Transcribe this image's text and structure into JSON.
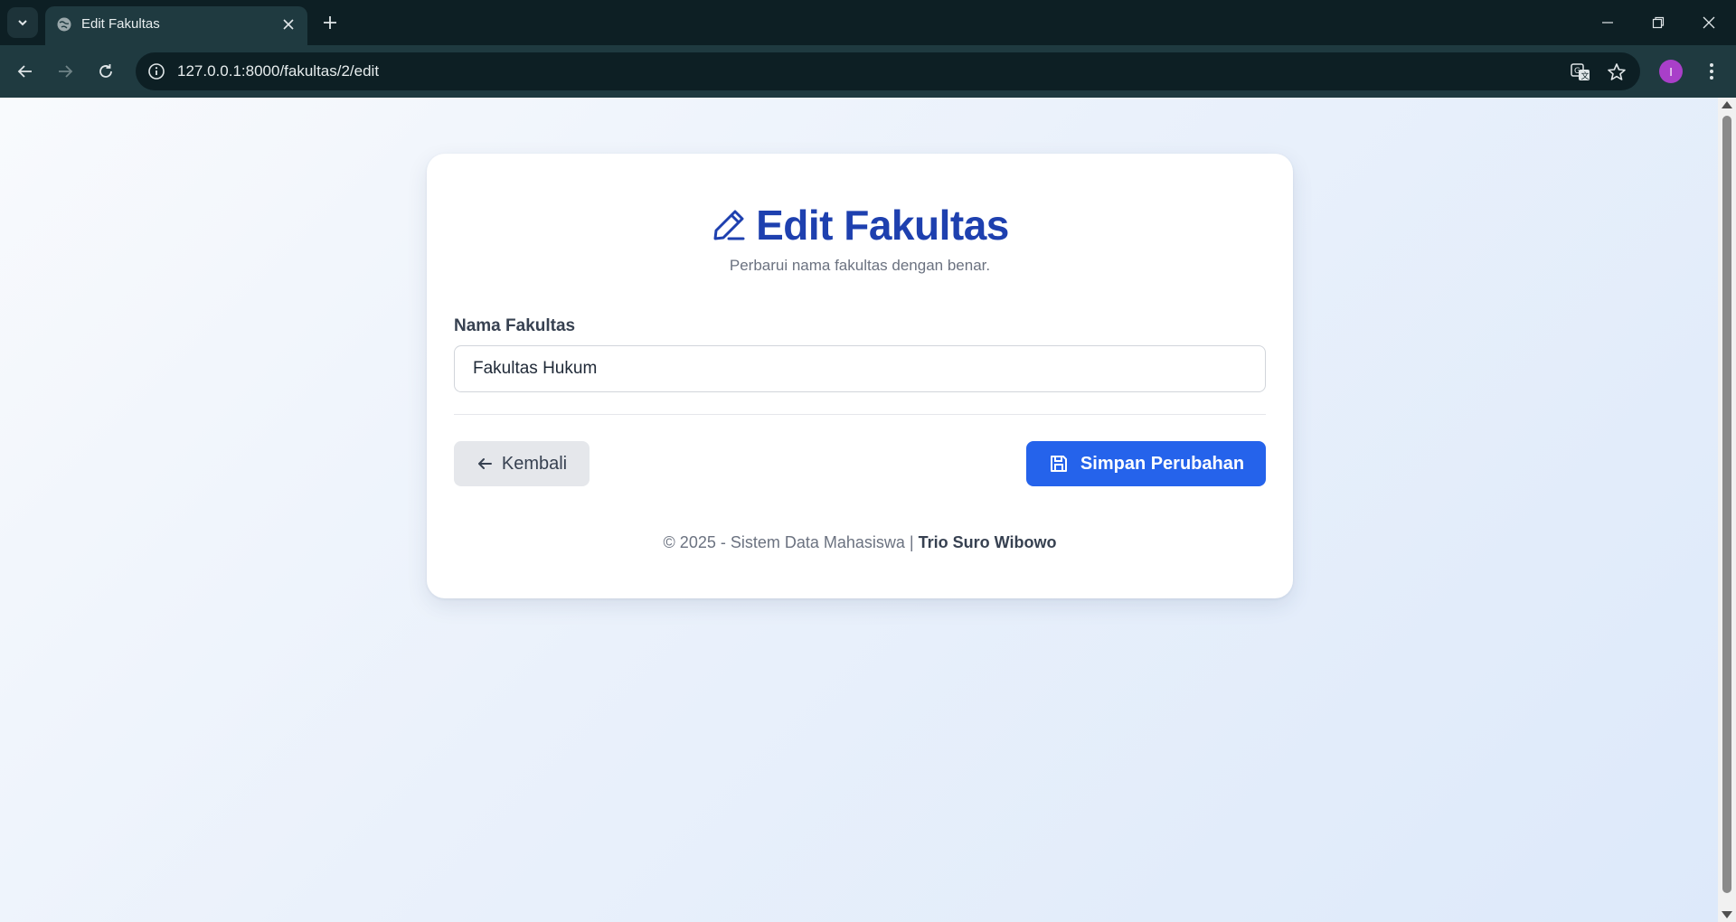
{
  "browser": {
    "tab_title": "Edit Fakultas",
    "url": "127.0.0.1:8000/fakultas/2/edit",
    "profile_initial": "I"
  },
  "page": {
    "title": "Edit Fakultas",
    "subtitle": "Perbarui nama fakultas dengan benar.",
    "field_label": "Nama Fakultas",
    "field_value": "Fakultas Hukum",
    "back_label": "Kembali",
    "save_label": "Simpan Perubahan",
    "footer_text": "© 2025 - Sistem Data Mahasiswa | ",
    "footer_author": "Trio Suro Wibowo"
  },
  "colors": {
    "accent": "#2563eb",
    "title": "#1e40af",
    "chrome_dark": "#0d1f24",
    "chrome_toolbar": "#1f3a40"
  },
  "icons": [
    "tab-list-icon",
    "globe-icon",
    "close-icon",
    "plus-icon",
    "minimize-icon",
    "restore-icon",
    "window-close-icon",
    "back-arrow-icon",
    "forward-arrow-icon",
    "reload-icon",
    "site-info-icon",
    "translate-icon",
    "star-icon",
    "more-menu-icon",
    "pencil-icon",
    "arrow-left-icon",
    "save-icon"
  ]
}
